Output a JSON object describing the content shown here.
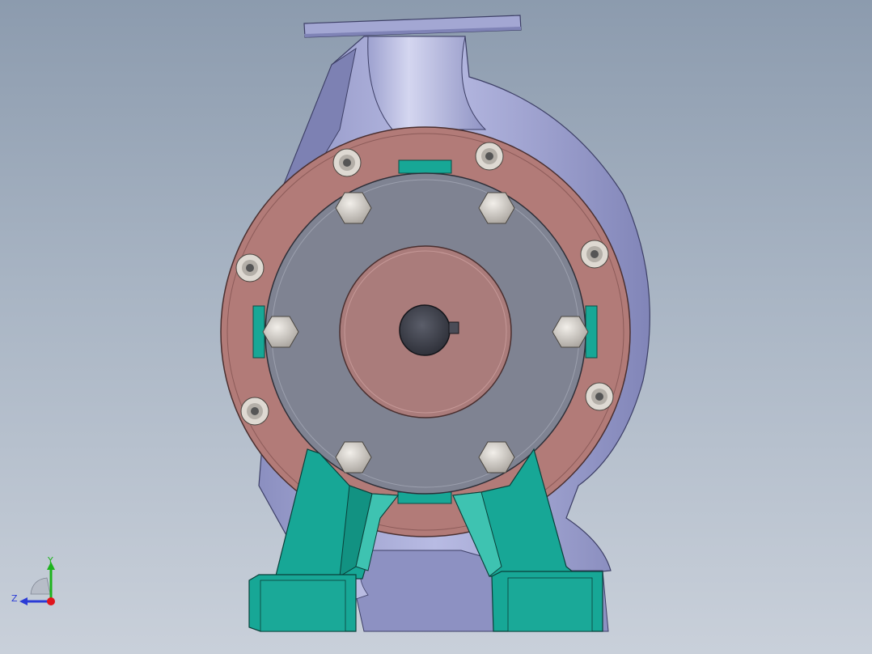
{
  "viewport": {
    "model_name": "",
    "background_top": "#8c9bae",
    "background_bottom": "#c9d0da"
  },
  "model": {
    "parts": [
      {
        "name": "volute-casing",
        "color": "#9196c6"
      },
      {
        "name": "discharge-flange",
        "color": "#a3a7d3"
      },
      {
        "name": "casing-cover-flange",
        "color": "#b27b78"
      },
      {
        "name": "bearing-bracket",
        "color": "#7f8392"
      },
      {
        "name": "shaft-hub",
        "color": "#aa7c7b"
      },
      {
        "name": "shaft",
        "color": "#3a3c46"
      },
      {
        "name": "pump-feet",
        "color": "#17a796"
      }
    ],
    "flange_bolt_count": 8,
    "bracket_hex_bolt_count": 6
  },
  "triad": {
    "y_label": "Y",
    "z_label": "Z",
    "y_color": "#1db31d",
    "z_color": "#2b3bd6",
    "x_color": "#e0141c"
  }
}
